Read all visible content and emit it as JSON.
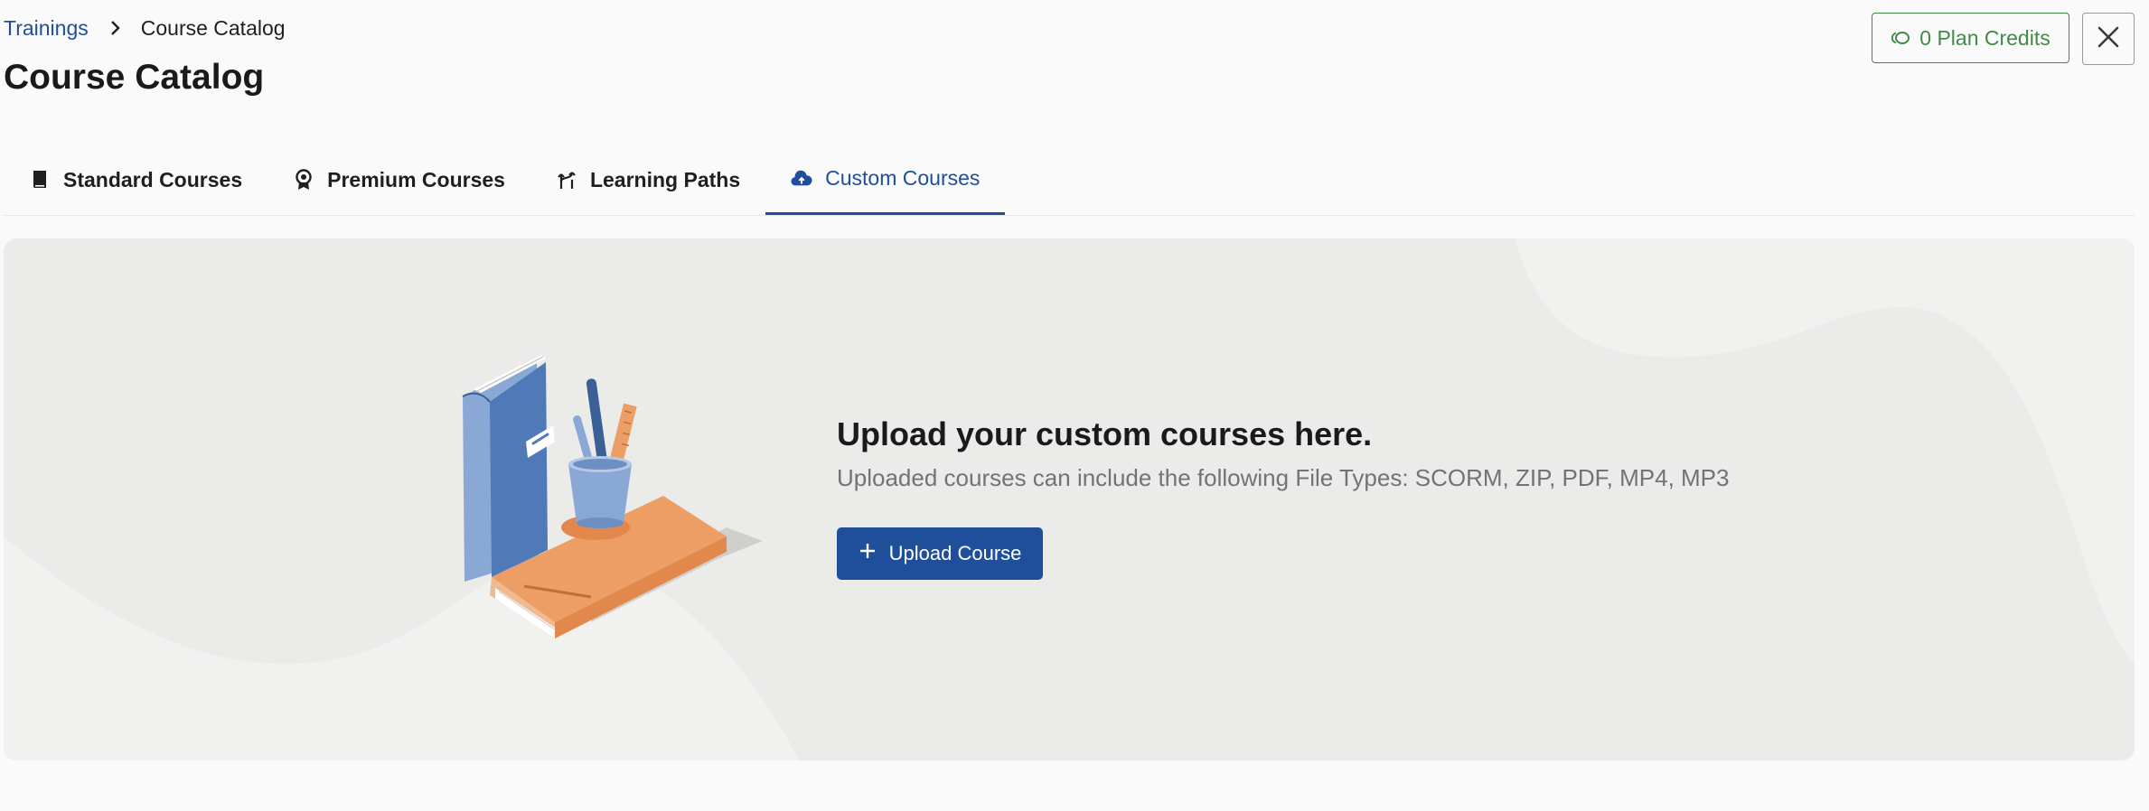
{
  "breadcrumb": {
    "parent": "Trainings",
    "current": "Course Catalog"
  },
  "page": {
    "title": "Course Catalog"
  },
  "header": {
    "credits_label": "0 Plan Credits",
    "close_icon": "close-icon"
  },
  "tabs": [
    {
      "label": "Standard Courses",
      "icon": "book-icon",
      "active": false
    },
    {
      "label": "Premium Courses",
      "icon": "award-icon",
      "active": false
    },
    {
      "label": "Learning Paths",
      "icon": "route-icon",
      "active": false
    },
    {
      "label": "Custom Courses",
      "icon": "cloud-upload-icon",
      "active": true
    }
  ],
  "empty_state": {
    "title": "Upload your custom courses here.",
    "subtitle": "Uploaded courses can include the following File Types: SCORM, ZIP, PDF, MP4, MP3",
    "button_label": "Upload Course",
    "button_icon": "plus-icon"
  },
  "colors": {
    "primary": "#1f4f9b",
    "credits": "#3f8b47",
    "hero_bg": "#ebebe9"
  }
}
